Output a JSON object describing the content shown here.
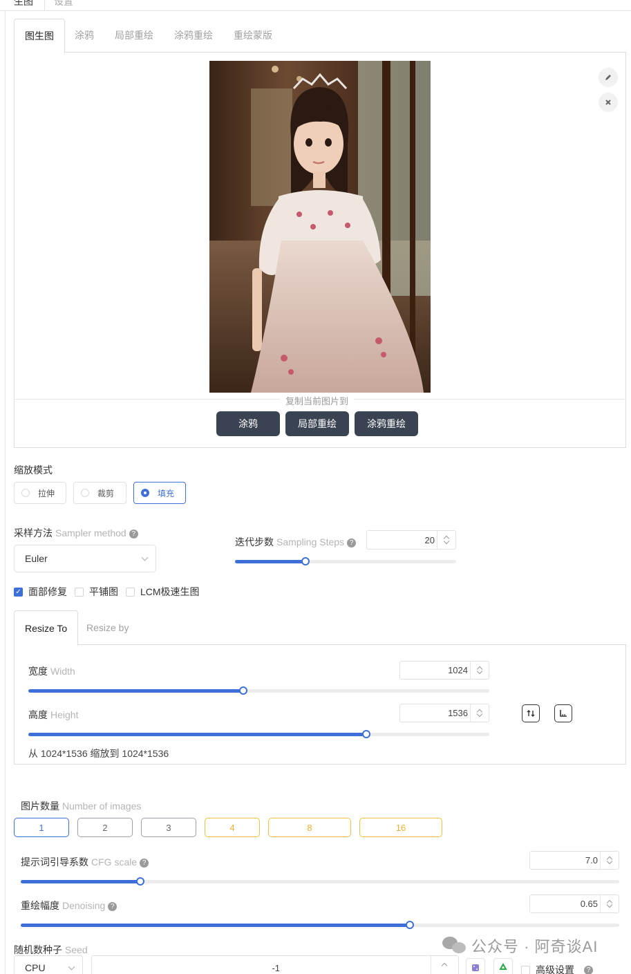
{
  "top_tabs": [
    "生图",
    "设置"
  ],
  "main_tabs": [
    "图生图",
    "涂鸦",
    "局部重绘",
    "涂鸦重绘",
    "重绘蒙版"
  ],
  "image_panel": {
    "edit_icon": "pencil-icon",
    "close_icon": "close-icon",
    "copy_to_label": "复制当前图片到",
    "copy_buttons": [
      "涂鸦",
      "局部重绘",
      "涂鸦重绘"
    ]
  },
  "resize_mode": {
    "label": "缩放模式",
    "options": [
      "拉伸",
      "裁剪",
      "填充"
    ],
    "selected": "填充"
  },
  "sampler": {
    "label": "采样方法",
    "label_en": "Sampler method",
    "value": "Euler"
  },
  "steps": {
    "label": "迭代步数",
    "label_en": "Sampling Steps",
    "value": "20",
    "fraction": 0.32
  },
  "checkboxes": [
    {
      "label": "面部修复",
      "checked": true
    },
    {
      "label": "平铺图",
      "checked": false
    },
    {
      "label": "LCM极速生图",
      "checked": false
    }
  ],
  "resize_tabs": [
    "Resize To",
    "Resize by"
  ],
  "width": {
    "label": "宽度",
    "label_en": "Width",
    "value": "1024",
    "fraction": 0.467
  },
  "height": {
    "label": "高度",
    "label_en": "Height",
    "value": "1536",
    "fraction": 0.733
  },
  "resize_summary": "从 1024*1536 缩放到 1024*1536",
  "batch": {
    "label": "图片数量",
    "label_en": "Number of images",
    "options": [
      "1",
      "2",
      "3",
      "4",
      "8",
      "16"
    ],
    "selected": "1"
  },
  "cfg": {
    "label": "提示词引导系数",
    "label_en": "CFG scale",
    "value": "7.0",
    "fraction": 0.2
  },
  "denoise": {
    "label": "重绘幅度",
    "label_en": "Denoising",
    "value": "0.65",
    "fraction": 0.65
  },
  "seed": {
    "label": "随机数种子",
    "label_en": "Seed",
    "device": "CPU",
    "value": "-1",
    "advanced_label": "高级设置"
  },
  "watermark": {
    "text": "公众号 · 阿奇谈AI",
    "icon": "wechat-icon"
  },
  "colors": {
    "accent": "#3d6fd9",
    "dark_button": "#3a4352",
    "warn": "#f0b030"
  }
}
